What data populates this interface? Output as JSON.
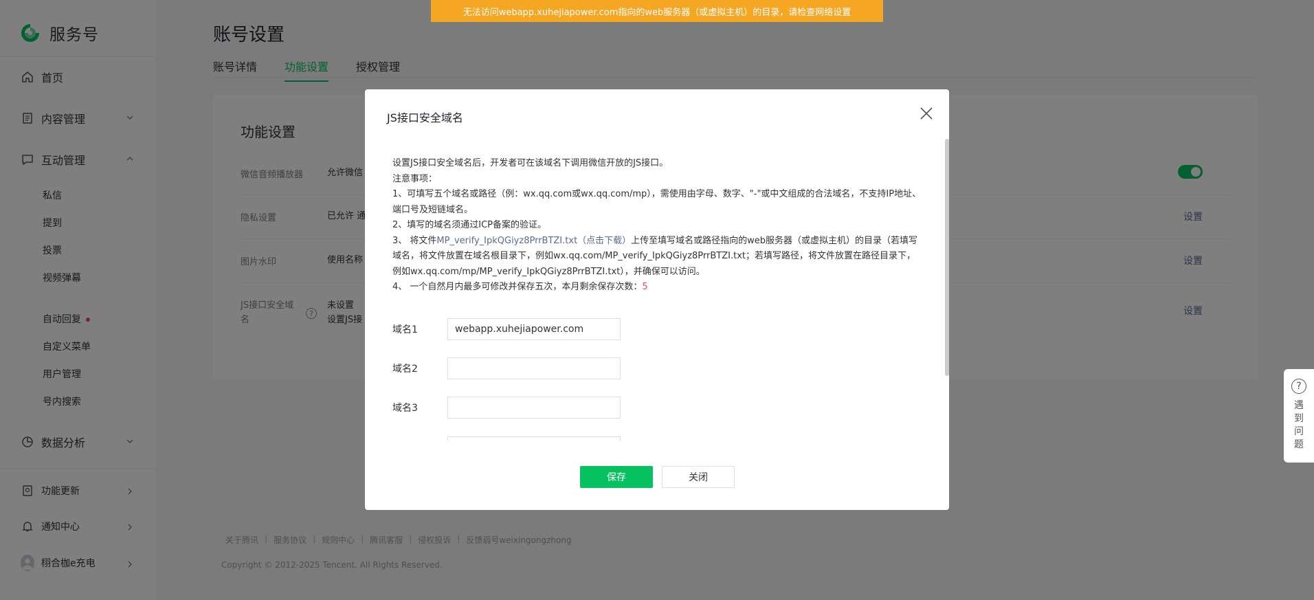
{
  "brand": {
    "name": "服务号",
    "color": "#07c160"
  },
  "sidebar": {
    "home": "首页",
    "content": "内容管理",
    "interaction": {
      "label": "互动管理",
      "items": [
        "私信",
        "提到",
        "投票",
        "视频弹幕",
        "自动回复",
        "自定义菜单",
        "用户管理",
        "号内搜索"
      ]
    },
    "data": "数据分析",
    "updates": "功能更新",
    "notices": "通知中心",
    "account": "栩合枷e充电"
  },
  "page": {
    "title": "账号设置",
    "tabs": [
      "账号详情",
      "功能设置",
      "授权管理"
    ],
    "active_tab": "功能设置"
  },
  "card": {
    "title": "功能设置",
    "rows": [
      {
        "label": "微信音频播放器",
        "value": "允许微信"
      },
      {
        "label": "隐私设置",
        "value": "已允许 通",
        "action": "设置"
      },
      {
        "label": "图片水印",
        "value": "使用名称",
        "action": "设置"
      },
      {
        "label": "JS接口安全域名",
        "value_line1": "未设置",
        "value_line2": "设置JS接",
        "action": "设置"
      }
    ]
  },
  "footer": {
    "links": [
      "关于腾讯",
      "服务协议",
      "规则中心",
      "腾讯客服",
      "侵权投诉",
      "反馈弱号weixingongzhong"
    ],
    "copyright": "Copyright © 2012-2025 Tencent. All Rights Reserved."
  },
  "banner": {
    "text": "无法访问webapp.xuhejiapower.com指向的web服务器（或虚拟主机）的目录，请检查网络设置",
    "color": "#f5a623"
  },
  "help": {
    "text": "遇到问题"
  },
  "modal": {
    "title": "JS接口安全域名",
    "intro": "设置JS接口安全域名后，开发者可在该域名下调用微信开放的JS接口。",
    "notes_title": "注意事项：",
    "note1": "1、可填写五个域名或路径（例：wx.qq.com或wx.qq.com/mp），需使用由字母、数字、\"-\"或中文组成的合法域名，不支持IP地址、端口号及短链域名。",
    "note2": "2、填写的域名须通过ICP备案的验证。",
    "note3_prefix": "3、 将文件",
    "note3_link": "MP_verify_IpkQGiyz8PrrBTZI.txt（点击下载）",
    "note3_suffix": "上传至填写域名或路径指向的web服务器（或虚拟主机）的目录（若填写域名，将文件放置在域名根目录下，例如wx.qq.com/MP_verify_IpkQGiyz8PrrBTZI.txt；若填写路径，将文件放置在路径目录下，例如wx.qq.com/mp/MP_verify_IpkQGiyz8PrrBTZI.txt），并确保可以访问。",
    "note4_prefix": "4、 一个自然月内最多可修改并保存五次，本月剩余保存次数：",
    "note4_count": "5",
    "fields": [
      {
        "label": "域名1",
        "value": "webapp.xuhejiapower.com"
      },
      {
        "label": "域名2",
        "value": ""
      },
      {
        "label": "域名3",
        "value": ""
      }
    ],
    "save": "保存",
    "close": "关闭"
  }
}
